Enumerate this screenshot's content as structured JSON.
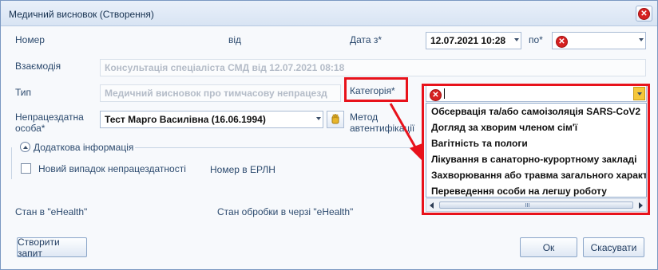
{
  "window": {
    "title": "Медичний висновок (Створення)"
  },
  "form": {
    "number_label": "Номер",
    "from_label": "від",
    "date_from_label": "Дата з*",
    "date_from_value": "12.07.2021 10:28",
    "to_label": "по*",
    "interaction_label": "Взаємодія",
    "interaction_value": "Консультація спеціаліста СМД від 12.07.2021 08:18",
    "type_label": "Тип",
    "type_value": "Медичний висновок про тимчасову непрацезд",
    "category_label": "Категорія*",
    "category_value": "",
    "person_label_1": "Непрацездатна",
    "person_label_2": "особа*",
    "person_value": "Тест Марго Василівна (16.06.1994)",
    "auth_label_1": "Метод",
    "auth_label_2": "автентифікації",
    "additional_info_label": "Додаткова інформація",
    "new_case_label": "Новий випадок непрацездатності",
    "erln_label": "Номер в ЕРЛН",
    "ehealth_state_label": "Стан в \"eHealth\"",
    "queue_state_label": "Стан обробки в черзі \"eHealth\""
  },
  "category_options": [
    "Обсервація та/або самоізоляція SARS-CoV2",
    "Догляд за хворим членом сім'ї",
    "Вагітність та пологи",
    "Лікування в санаторно-курортному закладі",
    "Захворювання або травма загального характе",
    "Переведення особи на легшу роботу"
  ],
  "buttons": {
    "create_request": "Створити запит",
    "ok": "Ок",
    "cancel": "Скасувати"
  },
  "colors": {
    "highlight": "#e8121b",
    "accent_border": "#7a98c2"
  }
}
